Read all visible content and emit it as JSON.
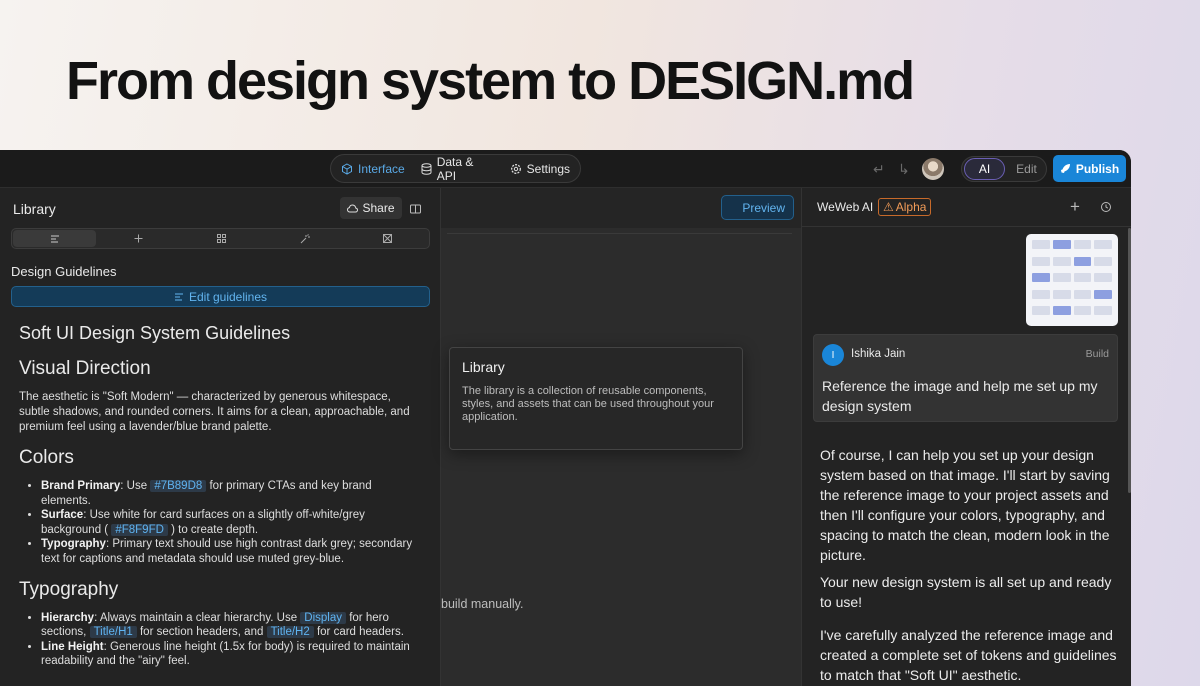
{
  "hero": {
    "title": "From design system to DESIGN.md"
  },
  "topbar": {
    "tabs": [
      {
        "label": "Interface",
        "icon": "cube-icon",
        "active": true
      },
      {
        "label": "Data & API",
        "icon": "database-icon",
        "active": false
      },
      {
        "label": "Settings",
        "icon": "gear-icon",
        "active": false
      }
    ],
    "mode_toggle": {
      "ai": "AI",
      "edit": "Edit",
      "selected": "AI"
    },
    "publish_label": "Publish"
  },
  "library": {
    "title": "Library",
    "share_label": "Share",
    "section_title": "Design Guidelines",
    "edit_label": "Edit guidelines",
    "doc": {
      "h1": "Soft UI Design System Guidelines",
      "visual_direction": {
        "heading": "Visual Direction",
        "text": "The aesthetic is \"Soft Modern\" — characterized by generous whitespace, subtle shadows, and rounded corners. It aims for a clean, approachable, and premium feel using a lavender/blue brand palette."
      },
      "colors": {
        "heading": "Colors",
        "brand_label": "Brand Primary",
        "brand_pre": ": Use ",
        "brand_code": "#7B89D8",
        "brand_post": " for primary CTAs and key brand elements.",
        "surface_label": "Surface",
        "surface_pre": ": Use white for card surfaces on a slightly off-white/grey background ( ",
        "surface_code": "#F8F9FD",
        "surface_post": " ) to create depth.",
        "typo_label": "Typography",
        "typo_text": ": Primary text should use high contrast dark grey; secondary text for captions and metadata should use muted grey-blue."
      },
      "typography": {
        "heading": "Typography",
        "hier_label": "Hierarchy",
        "hier_pre": ": Always maintain a clear hierarchy. Use ",
        "code_display": "Display",
        "hier_mid1": " for hero sections, ",
        "code_h1": "Title/H1",
        "hier_mid2": " for section headers, and ",
        "code_h2": "Title/H2",
        "hier_post": " for card headers.",
        "lh_label": "Line Height",
        "lh_text": ": Generous line height (1.5x for body) is required to maintain readability and the \"airy\" feel."
      }
    }
  },
  "canvas": {
    "preview_label": "Preview",
    "hint_text": "build manually."
  },
  "tooltip": {
    "title": "Library",
    "body": "The library is a collection of reusable components, styles, and assets that can be used throughout your application."
  },
  "ai_panel": {
    "title": "WeWeb AI",
    "badge": "Alpha",
    "message": {
      "avatar_letter": "I",
      "user": "Ishika Jain",
      "tag": "Build",
      "text": "Reference the image and help me set up my design system"
    },
    "reply": [
      "Of course, I can help you set up your design system based on that image. I'll start by saving the reference image to your project assets and then I'll configure your colors, typography, and spacing to match the clean, modern look in the picture.",
      "Your new design system is all set up and ready to use!",
      "I've carefully analyzed the reference image and created a complete set of tokens and guidelines to match that \"Soft UI\" aesthetic."
    ]
  },
  "colors": {
    "accent": "#1a86d8",
    "link": "#5aa9e6",
    "alpha": "#f19b58"
  }
}
